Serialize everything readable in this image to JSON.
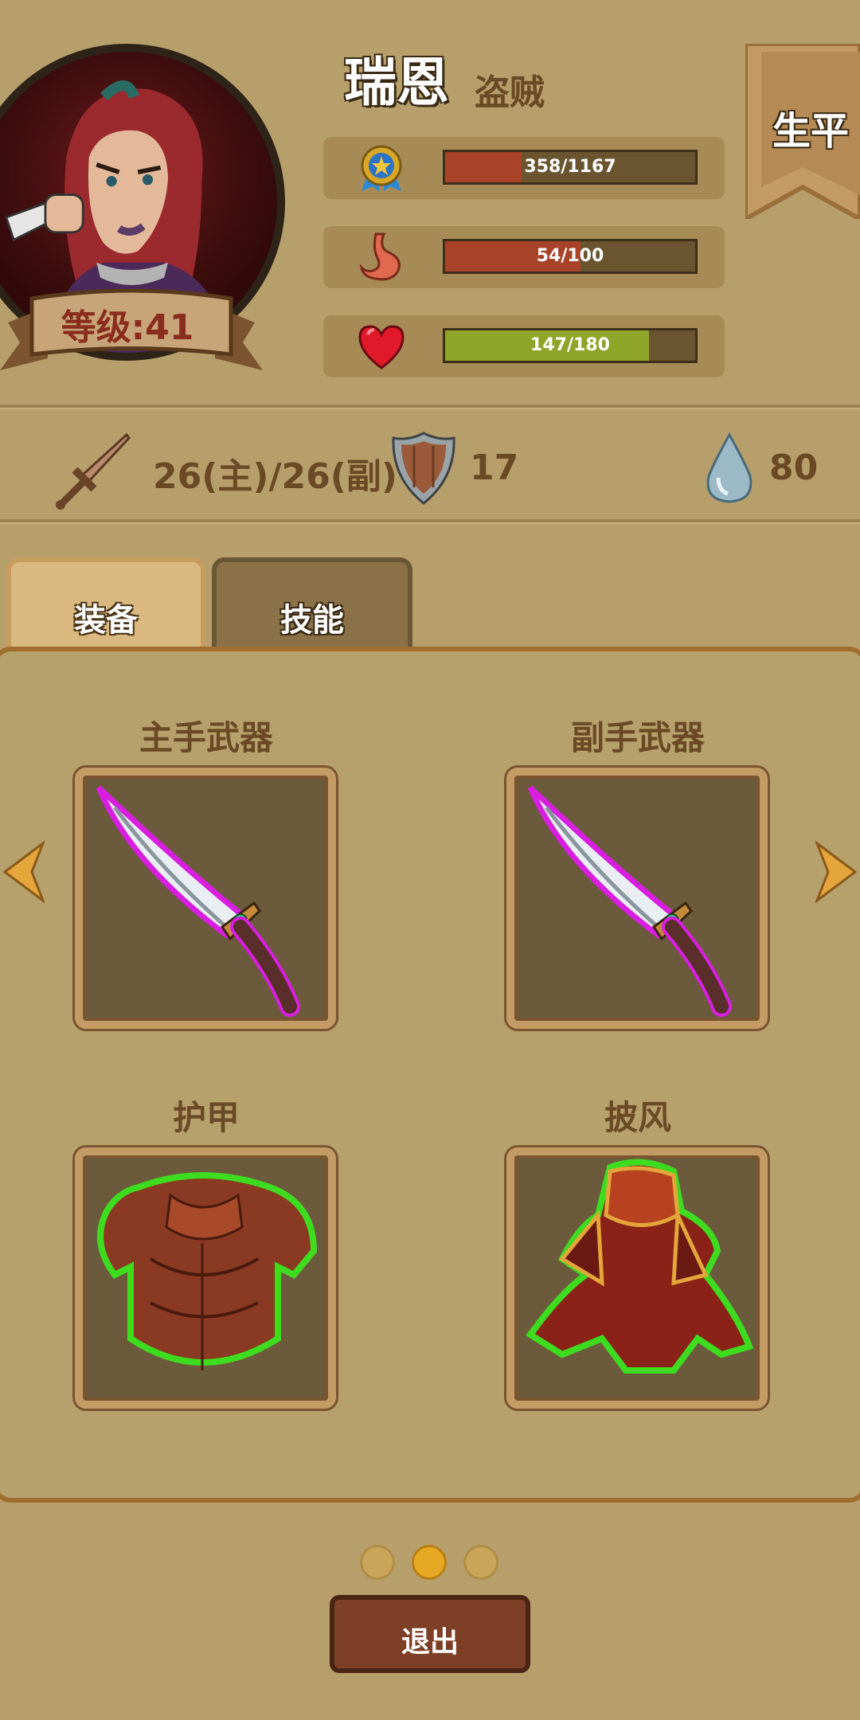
{
  "character": {
    "name": "瑞恩",
    "class": "盗贼",
    "level_label": "等级:41"
  },
  "bio_tab": {
    "label": "生平"
  },
  "stats": {
    "experience": {
      "text": "358/1167",
      "current": 358,
      "max": 1167,
      "icon": "medal-icon",
      "color": "#a8432a"
    },
    "hunger": {
      "text": "54/100",
      "current": 54,
      "max": 100,
      "icon": "stomach-icon",
      "color": "#a8432a"
    },
    "health": {
      "text": "147/180",
      "current": 147,
      "max": 180,
      "icon": "heart-icon",
      "color": "#8ea52a"
    }
  },
  "attributes": {
    "attack": {
      "text": "26(主)/26(副)",
      "icon": "sword-icon"
    },
    "defense": {
      "text": "17",
      "icon": "shield-icon"
    },
    "water": {
      "text": "80",
      "icon": "water-drop-icon"
    }
  },
  "tabs": [
    {
      "label": "装备",
      "active": true
    },
    {
      "label": "技能",
      "active": false
    }
  ],
  "equipment": {
    "main_hand": {
      "label": "主手武器",
      "icon": "dagger-icon",
      "rarity_color": "#d81ee0"
    },
    "off_hand": {
      "label": "副手武器",
      "icon": "dagger-icon",
      "rarity_color": "#d81ee0"
    },
    "armor": {
      "label": "护甲",
      "icon": "leather-armor-icon",
      "rarity_color": "#3ddc1f"
    },
    "cloak": {
      "label": "披风",
      "icon": "cloak-icon",
      "rarity_color": "#3ddc1f"
    }
  },
  "pagination": {
    "pages": 3,
    "current": 2
  },
  "exit_button": {
    "label": "退出"
  }
}
